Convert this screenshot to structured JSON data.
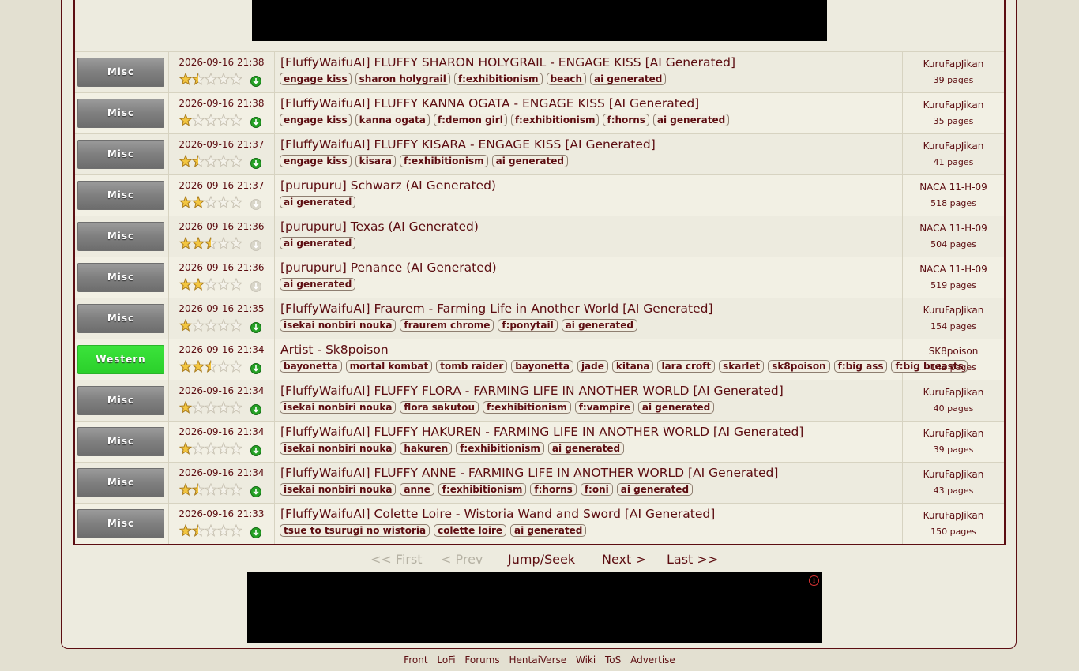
{
  "nav": {
    "first": "<< First",
    "prev": "< Prev",
    "jump": "Jump/Seek",
    "next": "Next >",
    "last": "Last >>"
  },
  "footer": [
    "Front",
    "LoFi",
    "Forums",
    "HentaiVerse",
    "Wiki",
    "ToS",
    "Advertise"
  ],
  "ad_icon": "i",
  "galleries": [
    {
      "category": "Misc",
      "date": "2026-09-16 21:38",
      "rating": 1.5,
      "download": true,
      "title": "[FluffyWaifuAI] FLUFFY SHARON HOLYGRAIL - ENGAGE KISS [AI Generated]",
      "tags": [
        "engage kiss",
        "sharon holygrail",
        "f:exhibitionism",
        "beach",
        "ai generated"
      ],
      "uploader": "KuruFapJikan",
      "pages": "39 pages"
    },
    {
      "category": "Misc",
      "date": "2026-09-16 21:38",
      "rating": 1,
      "download": true,
      "title": "[FluffyWaifuAI] FLUFFY KANNA OGATA - ENGAGE KISS [AI Generated]",
      "tags": [
        "engage kiss",
        "kanna ogata",
        "f:demon girl",
        "f:exhibitionism",
        "f:horns",
        "ai generated"
      ],
      "uploader": "KuruFapJikan",
      "pages": "35 pages"
    },
    {
      "category": "Misc",
      "date": "2026-09-16 21:37",
      "rating": 1.5,
      "download": true,
      "title": "[FluffyWaifuAI] FLUFFY KISARA - ENGAGE KISS [AI Generated]",
      "tags": [
        "engage kiss",
        "kisara",
        "f:exhibitionism",
        "ai generated"
      ],
      "uploader": "KuruFapJikan",
      "pages": "41 pages"
    },
    {
      "category": "Misc",
      "date": "2026-09-16 21:37",
      "rating": 2,
      "download": false,
      "title": "[purupuru] Schwarz (AI Generated)",
      "tags": [
        "ai generated"
      ],
      "uploader": "NACA 11-H-09",
      "pages": "518 pages"
    },
    {
      "category": "Misc",
      "date": "2026-09-16 21:36",
      "rating": 2.5,
      "download": false,
      "title": "[purupuru] Texas (AI Generated)",
      "tags": [
        "ai generated"
      ],
      "uploader": "NACA 11-H-09",
      "pages": "504 pages"
    },
    {
      "category": "Misc",
      "date": "2026-09-16 21:36",
      "rating": 2,
      "download": false,
      "title": "[purupuru] Penance (AI Generated)",
      "tags": [
        "ai generated"
      ],
      "uploader": "NACA 11-H-09",
      "pages": "519 pages"
    },
    {
      "category": "Misc",
      "date": "2026-09-16 21:35",
      "rating": 1,
      "download": true,
      "title": "[FluffyWaifuAI] Fraurem - Farming Life in Another World [AI Generated]",
      "tags": [
        "isekai nonbiri nouka",
        "fraurem chrome",
        "f:ponytail",
        "ai generated"
      ],
      "uploader": "KuruFapJikan",
      "pages": "154 pages"
    },
    {
      "category": "Western",
      "date": "2026-09-16 21:34",
      "rating": 2.5,
      "download": true,
      "title": "Artist - Sk8poison",
      "tags": [
        "bayonetta",
        "mortal kombat",
        "tomb raider",
        "bayonetta",
        "jade",
        "kitana",
        "lara croft",
        "skarlet",
        "sk8poison",
        "f:big ass",
        "f:big breasts"
      ],
      "uploader": "SK8poison",
      "pages": "142 pages"
    },
    {
      "category": "Misc",
      "date": "2026-09-16 21:34",
      "rating": 1,
      "download": true,
      "title": "[FluffyWaifuAI] FLUFFY FLORA - FARMING LIFE IN ANOTHER WORLD [AI Generated]",
      "tags": [
        "isekai nonbiri nouka",
        "flora sakutou",
        "f:exhibitionism",
        "f:vampire",
        "ai generated"
      ],
      "uploader": "KuruFapJikan",
      "pages": "40 pages"
    },
    {
      "category": "Misc",
      "date": "2026-09-16 21:34",
      "rating": 1,
      "download": true,
      "title": "[FluffyWaifuAI] FLUFFY HAKUREN - FARMING LIFE IN ANOTHER WORLD [AI Generated]",
      "tags": [
        "isekai nonbiri nouka",
        "hakuren",
        "f:exhibitionism",
        "ai generated"
      ],
      "uploader": "KuruFapJikan",
      "pages": "39 pages"
    },
    {
      "category": "Misc",
      "date": "2026-09-16 21:34",
      "rating": 1.5,
      "download": true,
      "title": "[FluffyWaifuAI] FLUFFY ANNE - FARMING LIFE IN ANOTHER WORLD [AI Generated]",
      "tags": [
        "isekai nonbiri nouka",
        "anne",
        "f:exhibitionism",
        "f:horns",
        "f:oni",
        "ai generated"
      ],
      "uploader": "KuruFapJikan",
      "pages": "43 pages"
    },
    {
      "category": "Misc",
      "date": "2026-09-16 21:33",
      "rating": 1.5,
      "download": true,
      "title": "[FluffyWaifuAI] Colette Loire - Wistoria Wand and Sword [AI Generated]",
      "tags": [
        "tsue to tsurugi no wistoria",
        "colette loire",
        "ai generated"
      ],
      "uploader": "KuruFapJikan",
      "pages": "150 pages"
    }
  ]
}
